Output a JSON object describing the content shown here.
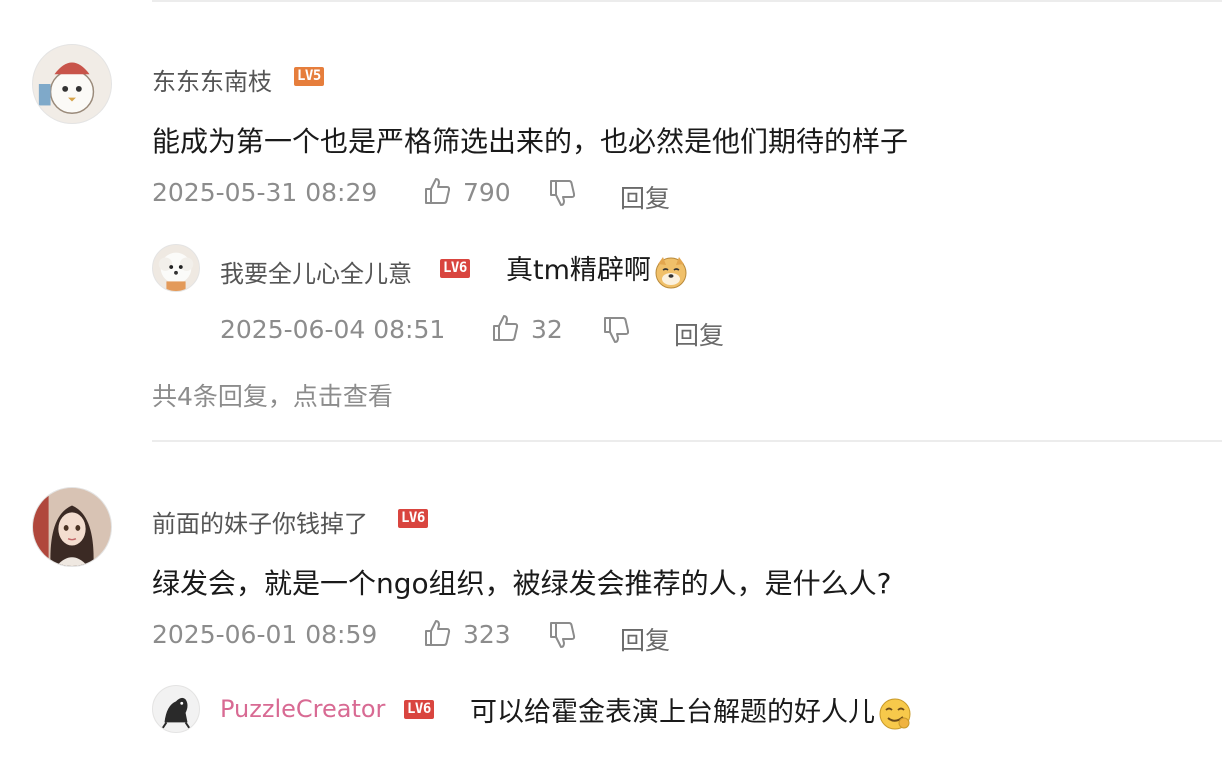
{
  "comments": [
    {
      "author": "东东东南枝",
      "level": "LV5",
      "text": "能成为第一个也是严格筛选出来的，也必然是他们期待的样子",
      "time": "2025-05-31 08:29",
      "likes": "790",
      "reply_label": "回复",
      "reply": {
        "author": "我要全儿心全儿意",
        "level": "LV6",
        "text": "真tm精辟啊",
        "time": "2025-06-04 08:51",
        "likes": "32",
        "reply_label": "回复"
      },
      "more_label": "共4条回复，点击查看"
    },
    {
      "author": "前面的妹子你钱掉了",
      "level": "LV6",
      "text": "绿发会，就是一个ngo组织，被绿发会推荐的人，是什么人?",
      "time": "2025-06-01 08:59",
      "likes": "323",
      "reply_label": "回复",
      "reply": {
        "author": "PuzzleCreator",
        "level": "LV6",
        "text": "可以给霍金表演上台解题的好人儿"
      }
    }
  ],
  "colors": {
    "lv5": "#e67e3c",
    "lv6": "#d9453f",
    "meta": "#8c8c8c",
    "pink_name": "#d86a93"
  },
  "icons": {
    "like": "thumbs-up-icon",
    "dislike": "thumbs-down-icon",
    "emoji1": "doge-emoji-icon",
    "emoji2": "smirk-emoji-icon"
  }
}
